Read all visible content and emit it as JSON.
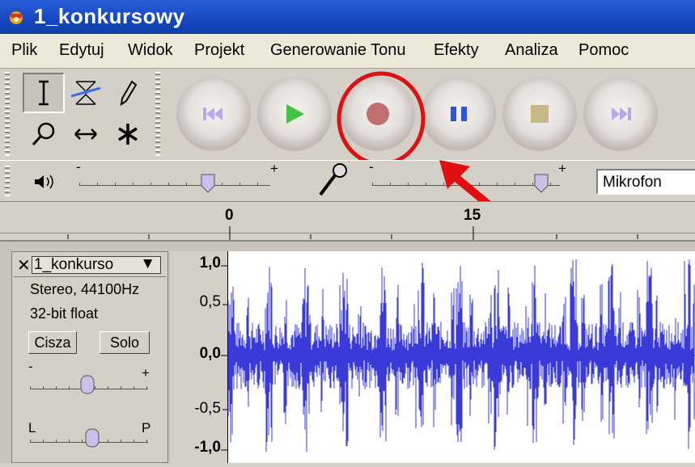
{
  "window": {
    "title": "1_konkursowy"
  },
  "menu": [
    "Plik",
    "Edytuj",
    "Widok",
    "Projekt",
    "Generowanie Tonu",
    "Efekty",
    "Analiza",
    "Pomoc"
  ],
  "tools": [
    "selection-tool",
    "envelope-tool",
    "draw-tool",
    "zoom-tool",
    "timeshift-tool",
    "multi-tool"
  ],
  "transport": [
    "skip-to-start",
    "play",
    "record",
    "pause",
    "stop",
    "skip-to-end"
  ],
  "meter": {
    "input_source": "Mikrofon",
    "minus": "-",
    "plus": "+"
  },
  "ruler": {
    "ticks": [
      "0",
      "15"
    ]
  },
  "track": {
    "name": "1_konkurso",
    "format": "Stereo, 44100Hz",
    "bitdepth": "32-bit float",
    "mute_label": "Cisza",
    "solo_label": "Solo",
    "gain_minus": "-",
    "gain_plus": "+",
    "pan_left": "L",
    "pan_right": "P"
  },
  "amp_scale": [
    "1,0",
    "0,5",
    "0,0",
    "-0,5",
    "-1,0"
  ],
  "colors": {
    "waveform": "#3a3ad8",
    "record_highlight": "#e01010",
    "title_bar": "#1546c0"
  }
}
